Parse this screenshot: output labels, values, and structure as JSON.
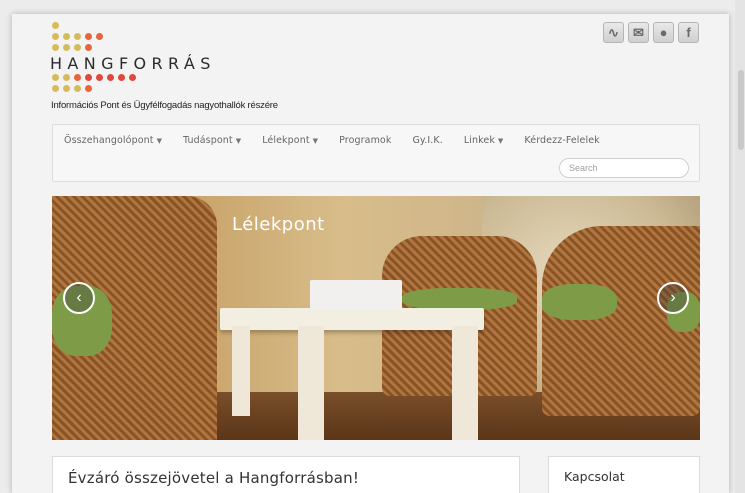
{
  "logo": {
    "text": "HANGFORRÁS",
    "tagline": "Információs Pont és Ügyfélfogadás nagyothallók részére"
  },
  "social": [
    {
      "icon": "rss-icon",
      "glyph": "∿"
    },
    {
      "icon": "email-icon",
      "glyph": "✉"
    },
    {
      "icon": "map-pin-icon",
      "glyph": "●"
    },
    {
      "icon": "facebook-icon",
      "glyph": "f"
    }
  ],
  "nav": {
    "items": [
      {
        "label": "Összehangolópont",
        "dropdown": true
      },
      {
        "label": "Tudáspont",
        "dropdown": true
      },
      {
        "label": "Lélekpont",
        "dropdown": true
      },
      {
        "label": "Programok",
        "dropdown": false
      },
      {
        "label": "Gy.I.K.",
        "dropdown": false
      },
      {
        "label": "Linkek",
        "dropdown": true
      },
      {
        "label": "Kérdezz-Felelek",
        "dropdown": false
      }
    ],
    "search_placeholder": "Search"
  },
  "slider": {
    "caption": "Lélekpont",
    "prev_glyph": "‹",
    "next_glyph": "›"
  },
  "post": {
    "title": "Évzáró összejövetel a Hangforrásban!",
    "meta": ""
  },
  "sidebar": {
    "title": "Kapcsolat",
    "text": ""
  },
  "colors": {
    "dot_orange": "#e8643a",
    "dot_gold": "#d6bb5b",
    "dot_red": "#e0483b"
  }
}
